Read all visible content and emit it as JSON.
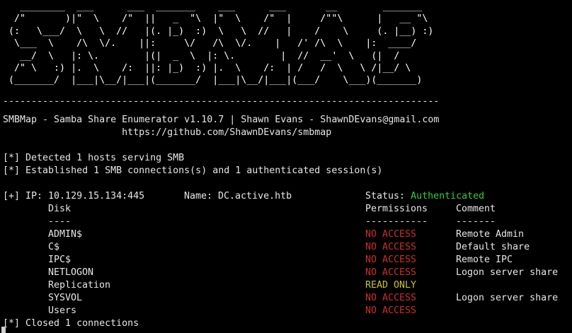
{
  "colors": {
    "background": "#000000",
    "text": "#e6e6e6",
    "authenticated": "#2fd12f",
    "no_access": "#d02b2b",
    "read_only": "#c9c22a"
  },
  "banner": {
    "ascii": "   ________  ___      ___  _______    ___      ___       __        _______\n  /\"       )|\"  \\    /\"  ||   _  \"\\  |\"  \\    /\"  |     /\"\"\\      |   __ \"\\\n (:   \\___/  \\   \\  //   |(. |_)  :)  \\   \\  //   |    /    \\     (. |__) :)\n  \\___  \\    /\\  \\/.    ||:     \\/   /\\  \\/.    |   /' /\\  \\    |:  ____/\n   __/  \\   |: \\.        |(|  _  \\  |: \\.        |  //  __'  \\   (|  /\n  /\" \\   :) |.  \\    /:  ||: |_)  :) |.  \\    /:  | /   /  \\   \\ /|__/ \\\n (_______/  |___|\\__/|___|(_______/  |___|\\__/|___|(___/    \\___)(_______)",
    "rule": "-----------------------------------------------------------------------------",
    "title": "SMBMap - Samba Share Enumerator v1.10.7 | Shawn Evans - ShawnDEvans@gmail.com",
    "url": "                     https://github.com/ShawnDEvans/smbmap"
  },
  "log": {
    "detected": "[*] Detected 1 hosts serving SMB",
    "established": "[*] Established 1 SMB connections(s) and 1 authenticated session(s)",
    "closed": "[*] Closed 1 connections"
  },
  "host": {
    "ip": "[+] IP: 10.129.15.134:445",
    "name": "Name: DC.active.htb",
    "status_label": "Status:",
    "status_value": "Authenticated"
  },
  "table": {
    "headers": {
      "disk": "Disk",
      "permissions": "Permissions",
      "comment": "Comment"
    },
    "underlines": {
      "disk": "----",
      "permissions": "-----------",
      "comment": "-------"
    },
    "rows": [
      {
        "disk": "ADMIN$",
        "permissions": "NO ACCESS",
        "comment": "Remote Admin"
      },
      {
        "disk": "C$",
        "permissions": "NO ACCESS",
        "comment": "Default share"
      },
      {
        "disk": "IPC$",
        "permissions": "NO ACCESS",
        "comment": "Remote IPC"
      },
      {
        "disk": "NETLOGON",
        "permissions": "NO ACCESS",
        "comment": "Logon server share"
      },
      {
        "disk": "Replication",
        "permissions": "READ ONLY",
        "comment": ""
      },
      {
        "disk": "SYSVOL",
        "permissions": "NO ACCESS",
        "comment": "Logon server share"
      },
      {
        "disk": "Users",
        "permissions": "NO ACCESS",
        "comment": ""
      }
    ]
  }
}
